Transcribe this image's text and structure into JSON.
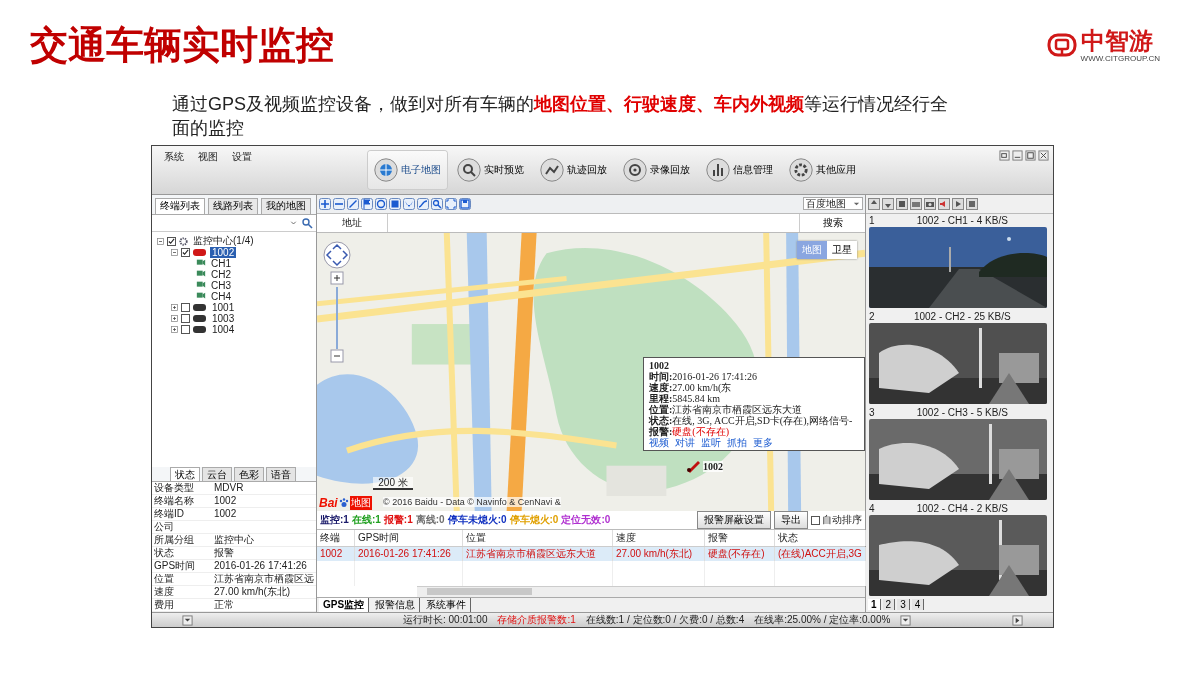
{
  "slide": {
    "title": "交通车辆实时监控",
    "logo": {
      "name": "中智游",
      "url": "WWW.CITGROUP.CN"
    },
    "description": "通过GPS及视频监控设备，做到对所有车辆的**地图位置、行驶速度、车内外视频**等运行情况经行全面的监控"
  },
  "window": {
    "menu": [
      "系统",
      "视图",
      "设置"
    ],
    "nav": [
      {
        "label": "电子地图",
        "selected": true
      },
      {
        "label": "实时预览",
        "selected": false
      },
      {
        "label": "轨迹回放",
        "selected": false
      },
      {
        "label": "录像回放",
        "selected": false
      },
      {
        "label": "信息管理",
        "selected": false
      },
      {
        "label": "其他应用",
        "selected": false
      }
    ],
    "left_tabs": [
      {
        "label": "终端列表",
        "selected": true
      },
      {
        "label": "线路列表",
        "selected": false
      },
      {
        "label": "我的地图",
        "selected": false
      }
    ],
    "tree": [
      {
        "label": "监控中心(1/4)",
        "kind": "group",
        "checked": true,
        "expanded": true,
        "selected": false,
        "children": [
          {
            "label": "1002",
            "kind": "vehicle",
            "color": "#d01818",
            "checked": true,
            "expanded": true,
            "selected": true,
            "children": [
              {
                "label": "CH1",
                "kind": "channel",
                "selected": false
              },
              {
                "label": "CH2",
                "kind": "channel",
                "selected": false
              },
              {
                "label": "CH3",
                "kind": "channel",
                "selected": false
              },
              {
                "label": "CH4",
                "kind": "channel",
                "selected": false
              }
            ]
          },
          {
            "label": "1001",
            "kind": "vehicle",
            "color": "#333333",
            "checked": false,
            "expanded": false,
            "selected": false
          },
          {
            "label": "1003",
            "kind": "vehicle",
            "color": "#333333",
            "checked": false,
            "expanded": false,
            "selected": false
          },
          {
            "label": "1004",
            "kind": "vehicle",
            "color": "#333333",
            "checked": false,
            "expanded": false,
            "selected": false
          }
        ]
      }
    ],
    "info_tabs": [
      {
        "label": "状态",
        "selected": true
      },
      {
        "label": "云台",
        "selected": false
      },
      {
        "label": "色彩",
        "selected": false
      },
      {
        "label": "语音",
        "selected": false
      }
    ],
    "properties": [
      {
        "name": "设备类型",
        "value": "MDVR"
      },
      {
        "name": "终端名称",
        "value": "1002"
      },
      {
        "name": "终端ID",
        "value": "1002"
      },
      {
        "name": "公司"
      },
      {
        "name": "所属分组",
        "value": "监控中心"
      },
      {
        "name": "状态",
        "value": "报警"
      },
      {
        "name": "GPS时间",
        "value": "2016-01-26 17:41:26"
      },
      {
        "name": "位置",
        "value": "江苏省南京市栖霞区远"
      },
      {
        "name": "速度",
        "value": "27.00 km/h(东北)"
      },
      {
        "name": "费用",
        "value": "正常"
      }
    ],
    "map": {
      "layer": "百度地图",
      "address_label": "地址",
      "search_button": "搜索",
      "map_types": [
        {
          "label": "地图",
          "selected": true
        },
        {
          "label": "卫星",
          "selected": false
        }
      ],
      "scale": "200 米",
      "logo": "Bai",
      "logo_suffix": "地图",
      "copyright": "© 2016 Baidu - Data © Navinfo & CenNavi &",
      "marker_label": "1002",
      "popup": {
        "title": "1002",
        "rows": [
          [
            {
              "label": "时间:",
              "value": "2016-01-26 17:41:26",
              "alert": false
            },
            {
              "label": "速度:",
              "value": "27.00 km/h(东",
              "alert": false
            }
          ],
          [
            {
              "label": "里程:",
              "value": "5845.84 km",
              "alert": false
            }
          ],
          [
            {
              "label": "位置:",
              "value": "江苏省南京市栖霞区远东大道",
              "alert": false
            }
          ],
          [
            {
              "label": "状态:",
              "value": "在线, 3G, ACC开启,SD卡(存在),网络信号-",
              "alert": false
            }
          ],
          [
            {
              "label": "报警:",
              "value": "硬盘(不存在)",
              "alert": true
            }
          ]
        ],
        "links": [
          "视频",
          "对讲",
          "监听",
          "抓拍",
          "更多"
        ]
      }
    },
    "summary": [
      {
        "label": "监控:1",
        "color": "#1a1a6a"
      },
      {
        "label": "在线:1",
        "color": "#20a020"
      },
      {
        "label": "报警:1",
        "color": "#e01010"
      },
      {
        "label": "离线:0",
        "color": "#707070"
      },
      {
        "label": "停车未熄火:0",
        "color": "#1030c0"
      },
      {
        "label": "停车熄火:0",
        "color": "#e0a000"
      },
      {
        "label": "定位无效:0",
        "color": "#b030d0"
      }
    ],
    "alarm_filter_button": "报警屏蔽设置",
    "export_button": "导出",
    "auto_sort": {
      "label": "自动排序",
      "checked": false
    },
    "table": {
      "columns": [
        "终端",
        "GPS时间",
        "位置",
        "速度",
        "报警",
        "状态"
      ],
      "rows": [
        {
          "selected": true,
          "alarm": true,
          "cells": [
            "1002",
            "2016-01-26 17:41:26",
            "江苏省南京市栖霞区远东大道",
            "27.00 km/h(东北)",
            "硬盘(不存在)",
            "(在线)ACC开启,3G"
          ]
        }
      ]
    },
    "bottom_tabs": [
      {
        "label": "GPS监控",
        "selected": true
      },
      {
        "label": "报警信息",
        "selected": false
      },
      {
        "label": "系统事件",
        "selected": false
      }
    ],
    "videos": [
      {
        "index": "1",
        "title": "1002 - CH1 - 4 KB/S",
        "kind": "picture"
      },
      {
        "index": "2",
        "title": "1002 - CH2 - 25 KB/S",
        "kind": "picture"
      },
      {
        "index": "3",
        "title": "1002 - CH3 - 5 KB/S",
        "kind": "picture"
      },
      {
        "index": "4",
        "title": "1002 - CH4 - 2 KB/S",
        "kind": "picture"
      }
    ],
    "video_pages": [
      {
        "label": "1",
        "selected": true
      },
      {
        "label": "2",
        "selected": false
      },
      {
        "label": "3",
        "selected": false
      },
      {
        "label": "4",
        "selected": false
      }
    ],
    "status": {
      "runtime": "运行时长: 00:01:00",
      "storage_alarm": "存储介质报警数:1",
      "counts": "在线数:1 / 定位数:0 / 欠费:0 / 总数:4",
      "rates": "在线率:25.00% / 定位率:0.00%"
    }
  }
}
